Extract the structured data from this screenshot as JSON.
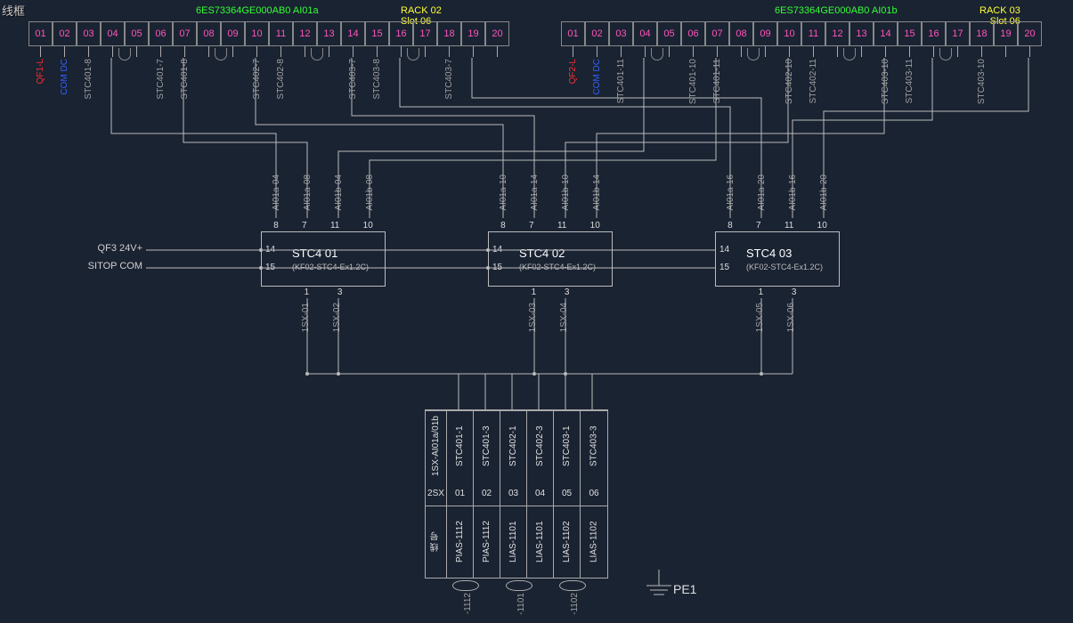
{
  "corner": "线框",
  "rack_a": {
    "part": "6ES73364GE000AB0   AI01a",
    "rack": "RACK 02",
    "slot": "Slot 06"
  },
  "rack_b": {
    "part": "6ES73364GE000AB0   AI01b",
    "rack": "RACK 03",
    "slot": "Slot 06"
  },
  "terms_a": [
    "01",
    "02",
    "03",
    "04",
    "05",
    "06",
    "07",
    "08",
    "09",
    "10",
    "11",
    "12",
    "13",
    "14",
    "15",
    "16",
    "17",
    "18",
    "19",
    "20"
  ],
  "terms_b": [
    "01",
    "02",
    "03",
    "04",
    "05",
    "06",
    "07",
    "08",
    "09",
    "10",
    "11",
    "12",
    "13",
    "14",
    "15",
    "16",
    "17",
    "18",
    "19",
    "20"
  ],
  "vlabels_a": {
    "0": {
      "t": "QF1-L",
      "cls": "qf"
    },
    "1": {
      "t": "COM DC",
      "cls": "com"
    },
    "2": {
      "t": "STC401-8",
      "cls": ""
    },
    "5": {
      "t": "STC401-7",
      "cls": ""
    },
    "6": {
      "t": "STC401-8",
      "cls": ""
    },
    "9": {
      "t": "STC402-7",
      "cls": ""
    },
    "10": {
      "t": "STC402-8",
      "cls": ""
    },
    "13": {
      "t": "STC403-7",
      "cls": ""
    },
    "14": {
      "t": "STC403-8",
      "cls": ""
    },
    "17": {
      "t": "STC403-7",
      "cls": ""
    }
  },
  "vlabels_b": {
    "0": {
      "t": "QF2-L",
      "cls": "qf"
    },
    "1": {
      "t": "COM DC",
      "cls": "com"
    },
    "2": {
      "t": "STC401-11",
      "cls": ""
    },
    "5": {
      "t": "STC401-10",
      "cls": ""
    },
    "6": {
      "t": "STC401-11",
      "cls": ""
    },
    "9": {
      "t": "STC402-10",
      "cls": ""
    },
    "10": {
      "t": "STC402-11",
      "cls": ""
    },
    "13": {
      "t": "STC403-10",
      "cls": ""
    },
    "14": {
      "t": "STC403-11",
      "cls": ""
    },
    "17": {
      "t": "STC403-10",
      "cls": ""
    }
  },
  "side": {
    "qf3": "QF3 24V+",
    "sitop": "SITOP COM"
  },
  "stc": [
    {
      "title": "STC4 01",
      "sub": "(KF02-STC4-Ex1.2C)",
      "top": [
        "8",
        "7",
        "11",
        "10"
      ],
      "bot": [
        "1",
        "3"
      ],
      "left": [
        "14",
        "15"
      ]
    },
    {
      "title": "STC4 02",
      "sub": "(KF02-STC4-Ex1.2C)",
      "top": [
        "8",
        "7",
        "11",
        "10"
      ],
      "bot": [
        "1",
        "3"
      ],
      "left": [
        "14",
        "15"
      ]
    },
    {
      "title": "STC4 03",
      "sub": "(KF02-STC4-Ex1.2C)",
      "top": [
        "8",
        "7",
        "11",
        "10"
      ],
      "bot": [
        "1",
        "3"
      ],
      "left": [
        "14",
        "15"
      ]
    }
  ],
  "ai_tags": [
    [
      "AI01a-04",
      "AI01a-08",
      "AI01b-04",
      "AI01b-08"
    ],
    [
      "AI01a-10",
      "AI01a-14",
      "AI01b-10",
      "AI01b-14"
    ],
    [
      "AI01a-16",
      "AI01a-20",
      "AI01b-16",
      "AI01b-20"
    ]
  ],
  "isx_tags": [
    [
      "1SX-01",
      "1SX-02"
    ],
    [
      "1SX-03",
      "1SX-04"
    ],
    [
      "1SX-05",
      "1SX-06"
    ]
  ],
  "table": {
    "colhead": [
      "1SX-AI01a/01b",
      "STC401-1",
      "STC401-3",
      "STC402-1",
      "STC402-3",
      "STC403-1",
      "STC403-3"
    ],
    "midrow": [
      "2SX",
      "01",
      "02",
      "03",
      "04",
      "05",
      "06"
    ],
    "xianhao": "线 号",
    "botrow": [
      "PIAS-1112",
      "PIAS-1112",
      "LIAS-1101",
      "LIAS-1101",
      "LIAS-1102",
      "LIAS-1102"
    ]
  },
  "tails": [
    "-1112",
    "-1101",
    "-1102"
  ],
  "pe": "PE1"
}
